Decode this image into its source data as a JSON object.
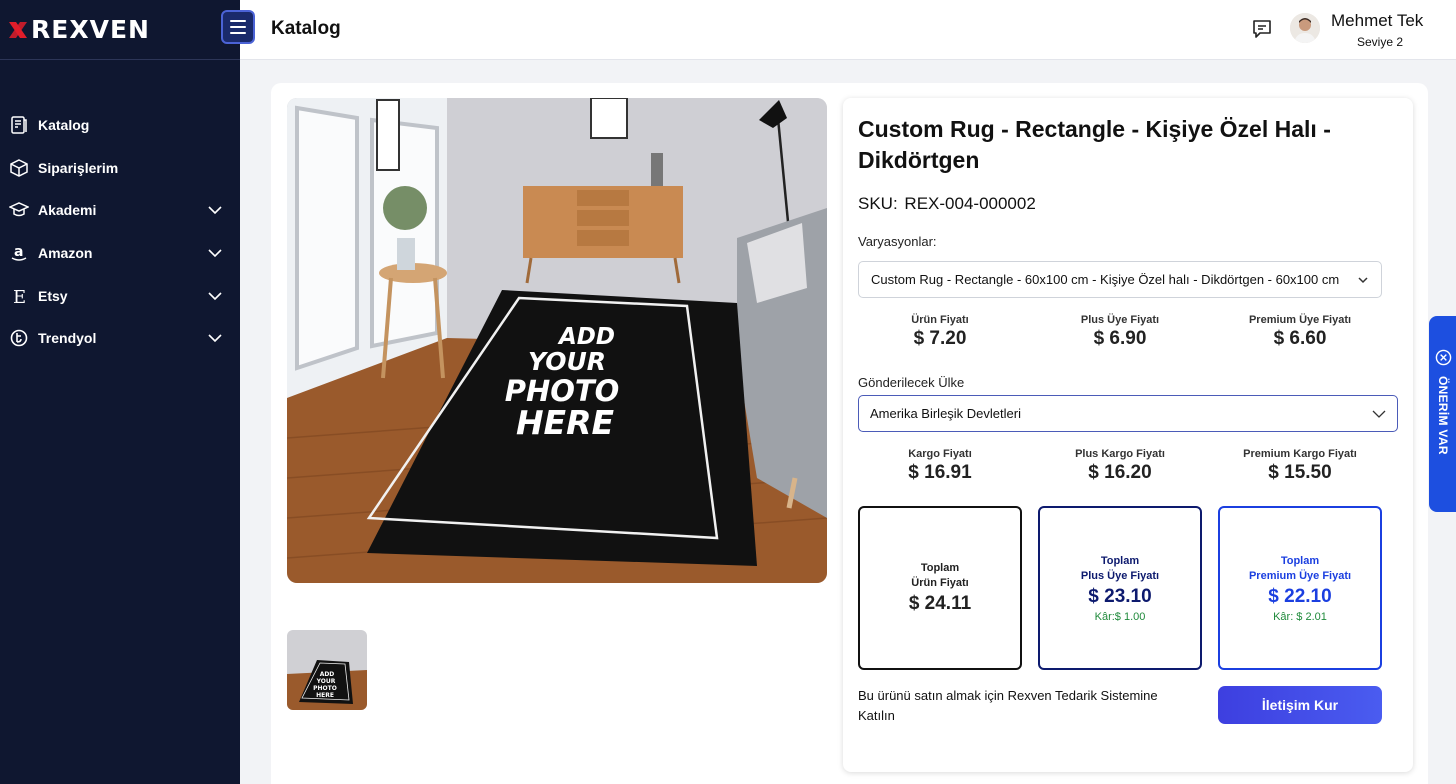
{
  "brand": {
    "name": "REXVEN",
    "accent": "#e11d2a"
  },
  "sidebar": {
    "items": [
      {
        "label": "Katalog",
        "icon": "catalog-icon",
        "expandable": false
      },
      {
        "label": "Siparişlerim",
        "icon": "box-icon",
        "expandable": false
      },
      {
        "label": "Akademi",
        "icon": "graduation-cap-icon",
        "expandable": true
      },
      {
        "label": "Amazon",
        "icon": "amazon-icon",
        "expandable": true
      },
      {
        "label": "Etsy",
        "icon": "etsy-icon",
        "expandable": true
      },
      {
        "label": "Trendyol",
        "icon": "trendyol-icon",
        "expandable": true
      }
    ]
  },
  "header": {
    "title": "Katalog",
    "user": {
      "name": "Mehmet Tek",
      "level": "Seviye 2"
    }
  },
  "product": {
    "title": "Custom Rug - Rectangle - Kişiye Özel Halı - Dikdörtgen",
    "sku_label": "SKU:",
    "sku": "REX-004-000002",
    "image_text": [
      "ADD",
      "YOUR",
      "PHOTO",
      "HERE"
    ],
    "variations_label": "Varyasyonlar:",
    "variation_selected": "Custom Rug - Rectangle - 60x100 cm - Kişiye Özel halı - Dikdörtgen - 60x100 cm",
    "prices": [
      {
        "label": "Ürün Fiyatı",
        "value": "$ 7.20"
      },
      {
        "label": "Plus Üye Fiyatı",
        "value": "$ 6.90"
      },
      {
        "label": "Premium Üye Fiyatı",
        "value": "$ 6.60"
      }
    ],
    "country_label": "Gönderilecek Ülke",
    "country_selected": "Amerika Birleşik Devletleri",
    "shipping": [
      {
        "label": "Kargo Fiyatı",
        "value": "$ 16.91"
      },
      {
        "label": "Plus Kargo Fiyatı",
        "value": "$ 16.20"
      },
      {
        "label": "Premium Kargo Fiyatı",
        "value": "$ 15.50"
      }
    ],
    "totals": [
      {
        "line1": "Toplam",
        "line2": "Ürün Fiyatı",
        "value": "$ 24.11",
        "profit": ""
      },
      {
        "line1": "Toplam",
        "line2": "Plus Üye Fiyatı",
        "value": "$ 23.10",
        "profit": "Kâr:$ 1.00"
      },
      {
        "line1": "Toplam",
        "line2": "Premium Üye Fiyatı",
        "value": "$ 22.10",
        "profit": "Kâr: $ 2.01"
      }
    ],
    "join_text": "Bu ürünü satın almak için Rexven Tedarik Sistemine Katılın",
    "contact_button": "İletişim Kur"
  },
  "suggestion_tab": {
    "label": "ÖNERİM VAR"
  },
  "colors": {
    "sidebar_bg": "#0f1730",
    "primary": "#1b3fe0",
    "plus": "#0d1a6e",
    "profit": "#1f8a3b"
  }
}
